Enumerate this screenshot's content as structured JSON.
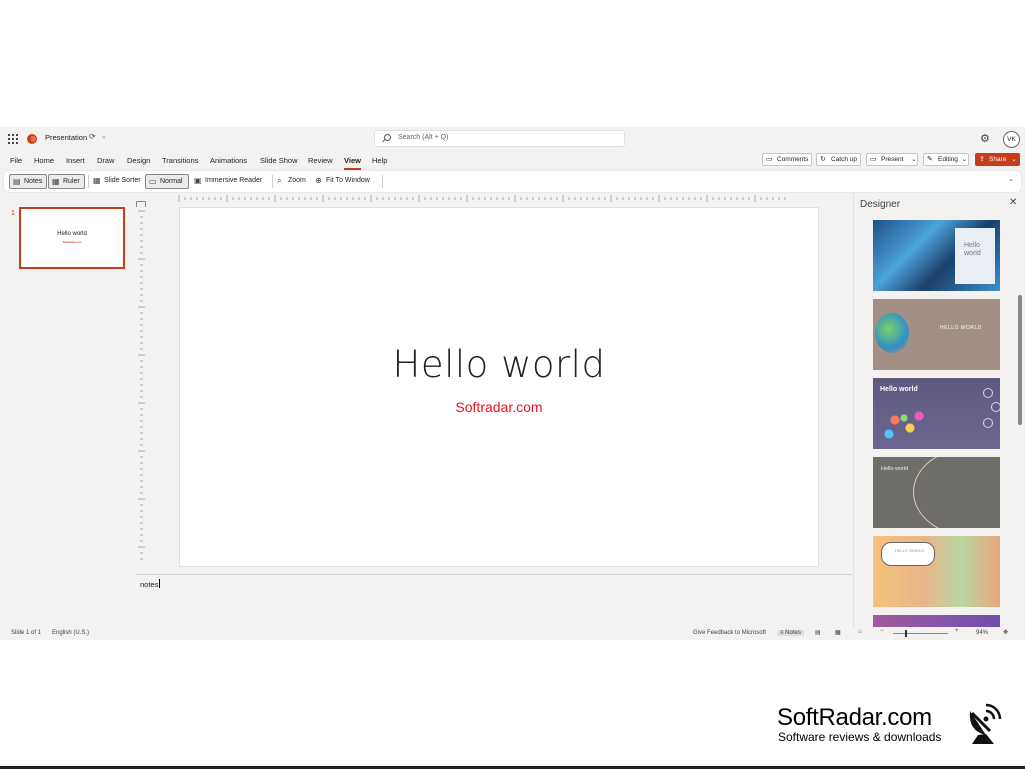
{
  "app": {
    "doc_title": "Presentation",
    "search_placeholder": "Search (Alt + Q)",
    "user_initials": "VK"
  },
  "menu": {
    "tabs": [
      "File",
      "Home",
      "Insert",
      "Draw",
      "Design",
      "Transitions",
      "Animations",
      "Slide Show",
      "Review",
      "View",
      "Help"
    ],
    "active_tab": "View",
    "comments": "Comments",
    "catch_up": "Catch up",
    "present": "Present",
    "editing": "Editing",
    "share": "Share"
  },
  "ribbon": {
    "notes": "Notes",
    "ruler": "Ruler",
    "slide_sorter": "Slide Sorter",
    "normal": "Normal",
    "immersive_reader": "Immersive Reader",
    "zoom": "Zoom",
    "fit_to_window": "Fit To Window"
  },
  "thumbnail": {
    "number": "1",
    "title": "Hello world",
    "subtitle": "Softradar.com"
  },
  "slide": {
    "title": "Hello world",
    "subtitle": "Softradar.com"
  },
  "notes": {
    "text": "notes"
  },
  "designer": {
    "title": "Designer",
    "designs": [
      {
        "title": "Hello world"
      },
      {
        "title": "HELLO WORLD"
      },
      {
        "title": "Hello world"
      },
      {
        "title": "Hello world"
      },
      {
        "title": "HELLO WORLD"
      }
    ]
  },
  "status": {
    "slide_count": "Slide 1 of 1",
    "language": "English (U.S.)",
    "feedback": "Give Feedback to Microsoft",
    "notes": "Notes",
    "zoom_level": "94%"
  },
  "watermark": {
    "title": "SoftRadar.com",
    "tagline": "Software reviews & downloads"
  },
  "colors": {
    "accent": "#c43e1c",
    "subtitle_red": "#e81123"
  }
}
